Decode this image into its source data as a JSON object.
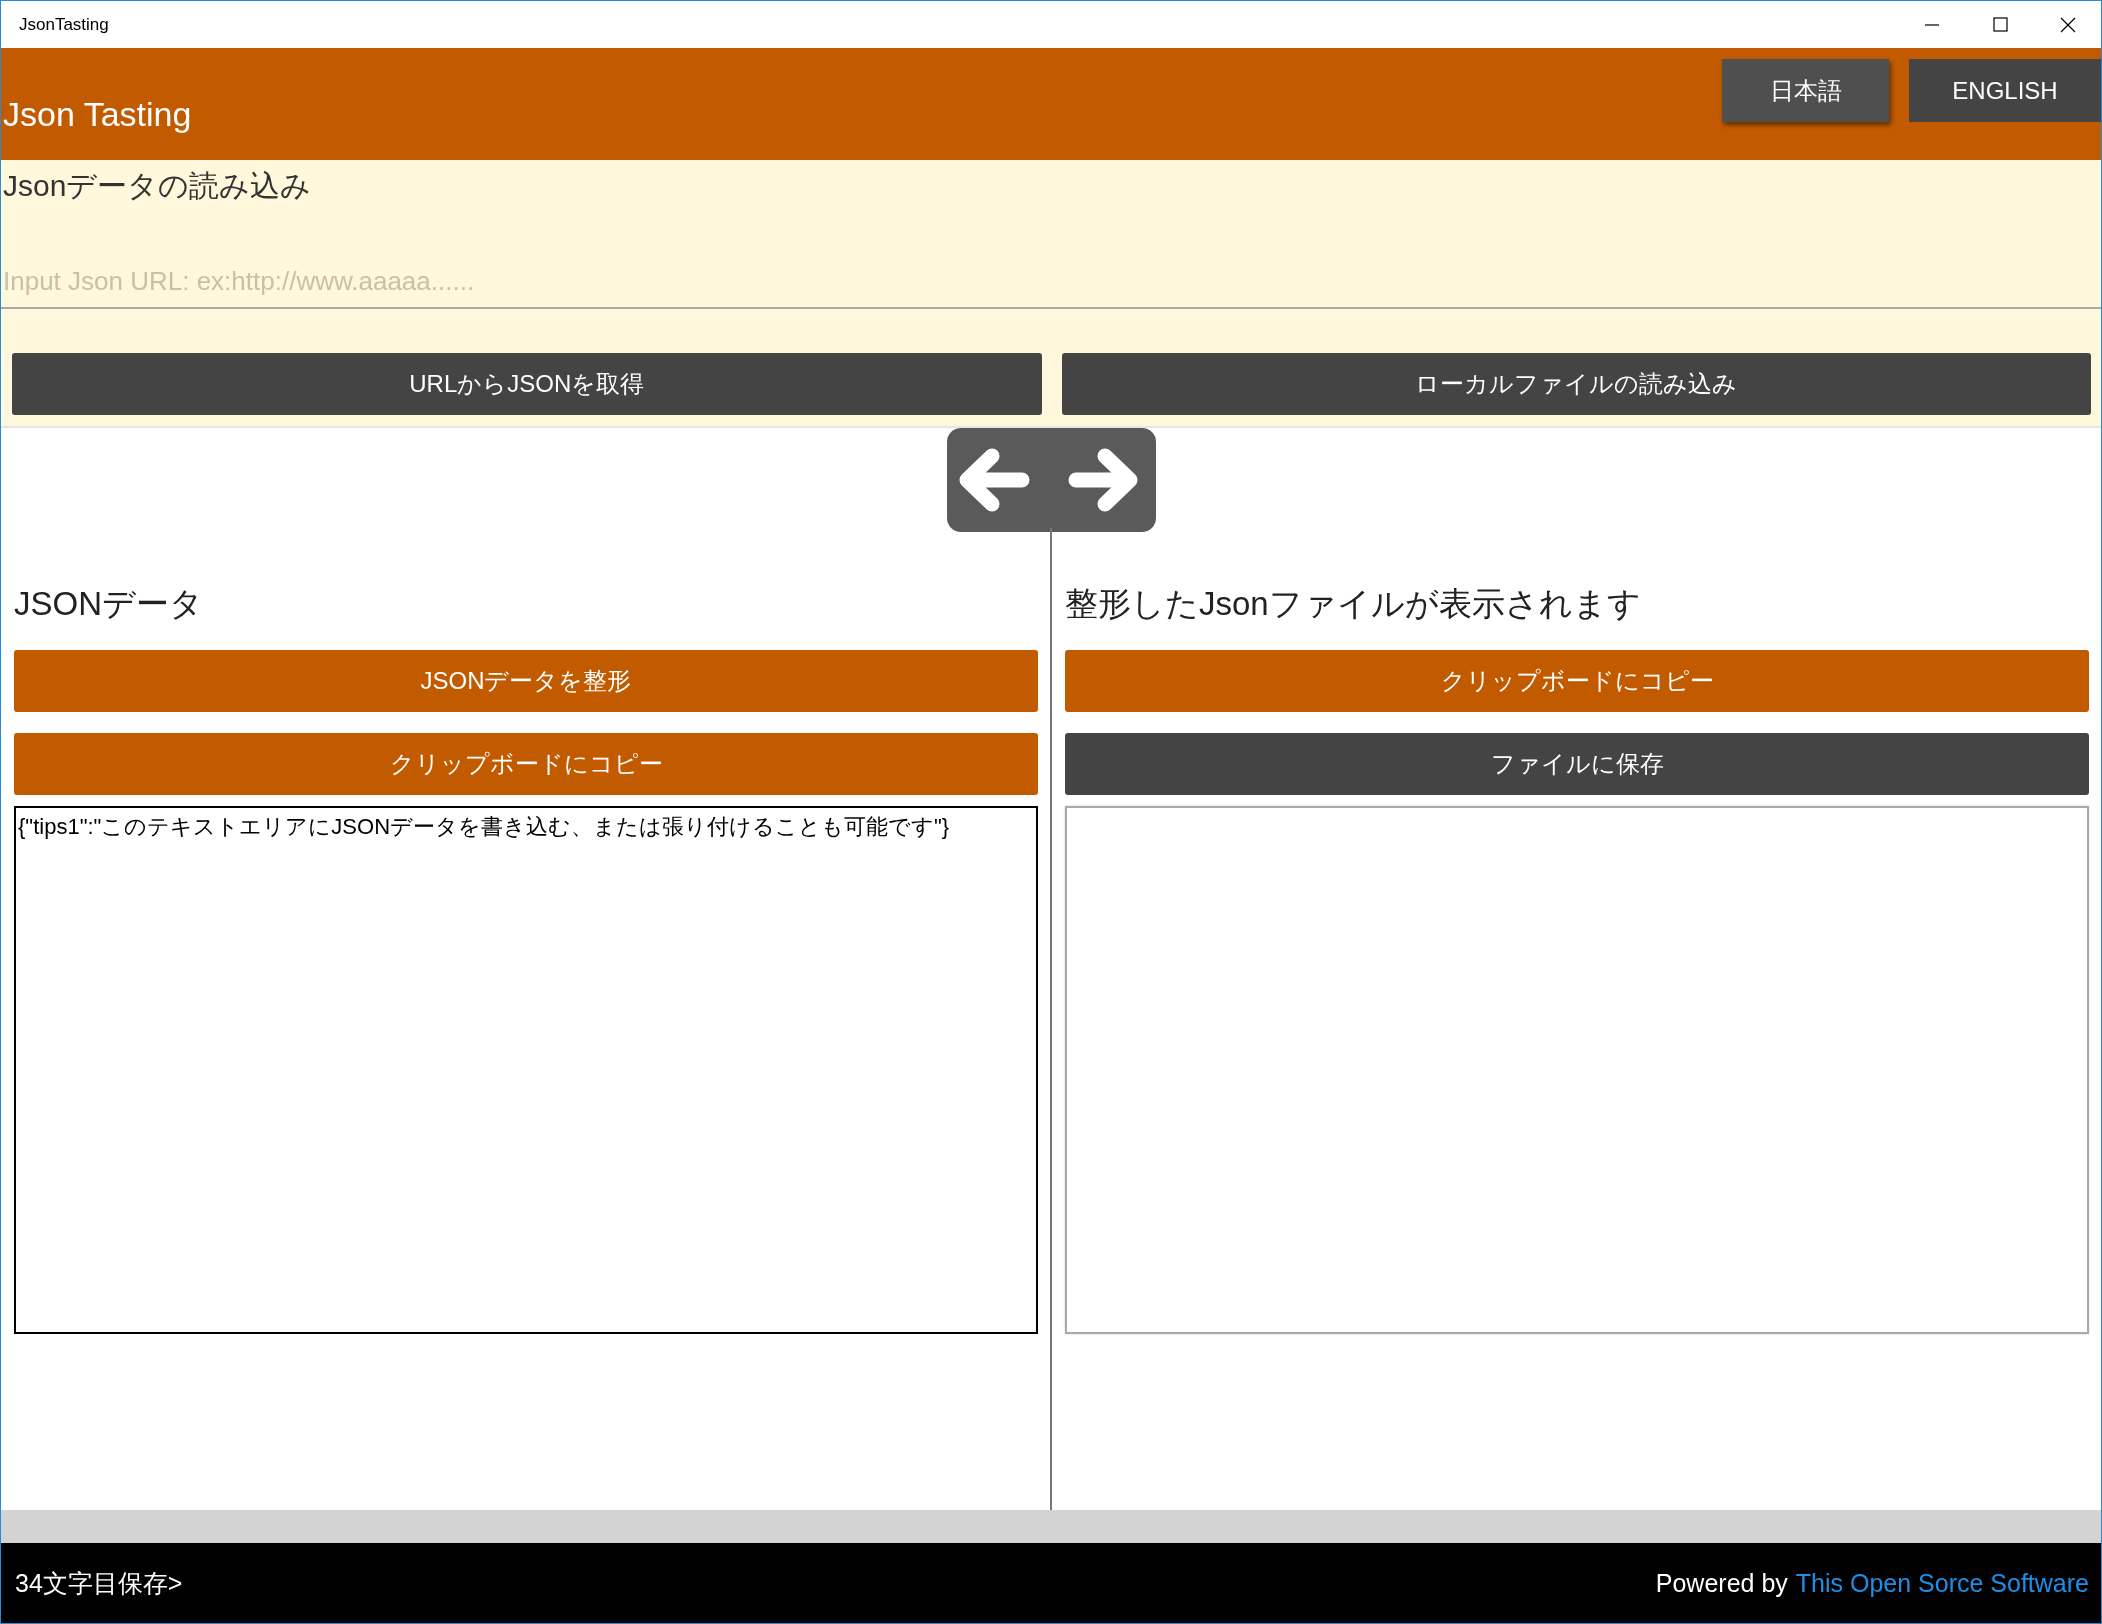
{
  "window": {
    "title": "JsonTasting"
  },
  "header": {
    "title": "Json Tasting",
    "languages": [
      {
        "label": "日本語",
        "selected": true
      },
      {
        "label": "ENGLISH",
        "selected": false
      }
    ]
  },
  "load": {
    "heading": "Jsonデータの読み込み",
    "url_field": {
      "placeholder": "Input Json URL: ex:http://www.aaaaa......"
    },
    "buttons": [
      "URLからJSONを取得",
      "ローカルファイルの読み込み"
    ]
  },
  "panes": [
    {
      "heading": "JSONデータ",
      "focused": true,
      "buttons": [
        {
          "label": "JSONデータを整形",
          "kind": "primary"
        },
        {
          "label": "クリップボードにコピー",
          "kind": "primary"
        }
      ],
      "text": "{\"tips1\":\"このテキストエリアにJSONデータを書き込む、または張り付けることも可能です\"}"
    },
    {
      "heading": "整形したJsonファイルが表示されます",
      "focused": false,
      "buttons": [
        {
          "label": "クリップボードにコピー",
          "kind": "primary"
        },
        {
          "label": "ファイルに保存",
          "kind": "secondary"
        }
      ]
    }
  ],
  "footer": {
    "status": "34文字目保存>",
    "credit": "Powered by",
    "link": "This Open Sorce Software"
  }
}
